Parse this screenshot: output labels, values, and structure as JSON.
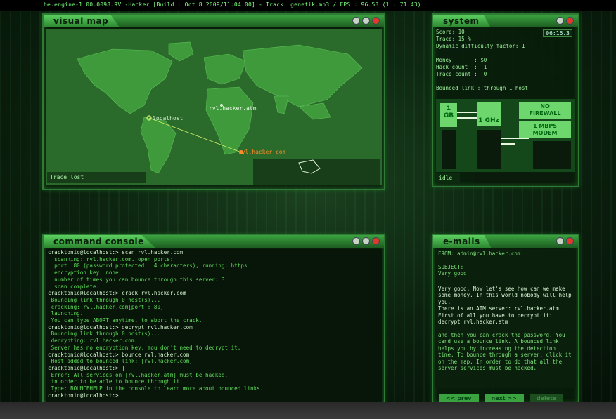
{
  "topbar": {
    "text": "he.engine-1.00.0098.RVL-Hacker [Build : Oct  8 2009/11:04:00] - Track: genetik.mp3 / FPS : 96.53 (1 : 71.43)"
  },
  "map_panel": {
    "title": "visual map",
    "status": "Trace lost",
    "nodes": {
      "localhost": "localhost",
      "atm": "rvl.hacker.atm",
      "com": "rvl.hacker.com"
    }
  },
  "system_panel": {
    "title": "system",
    "clock": "06:16.3",
    "lines": [
      "Score: 10",
      "Trace: 15 %",
      "Dynamic difficulty factor: 1",
      "",
      "Money       : $0",
      "Hack count  :  1",
      "Trace count :  0",
      "",
      "Bounced link : through 1 host"
    ],
    "hardware": {
      "ram": "1\nGB",
      "cpu": "1 GHz",
      "firewall": "NO\nFIREWALL",
      "modem": "1 MBPS\nMODEM"
    },
    "status": "idle"
  },
  "console_panel": {
    "title": "command console",
    "lines": [
      {
        "t": "cmd",
        "text": "cracktonic@localhost:> scan rvl.hacker.com"
      },
      {
        "t": "out",
        "text": "  scanning: rvl.hacker.com. open ports:"
      },
      {
        "t": "out",
        "text": "  port  80 (password protected:  4 characters), running: https"
      },
      {
        "t": "out",
        "text": "  encryption key: none"
      },
      {
        "t": "out",
        "text": "  number of times you can bounce through this server: 3"
      },
      {
        "t": "out",
        "text": "  scan complete."
      },
      {
        "t": "cmd",
        "text": "cracktonic@localhost:> crack rvl.hacker.com"
      },
      {
        "t": "out",
        "text": " Bouncing link through 0 host(s)..."
      },
      {
        "t": "out",
        "text": " cracking: rvl.hacker.com[port : 80]"
      },
      {
        "t": "out",
        "text": " launching."
      },
      {
        "t": "out",
        "text": " You can type ABORT anytime. to abort the crack."
      },
      {
        "t": "cmd",
        "text": "cracktonic@localhost:> decrypt rvl.hacker.com"
      },
      {
        "t": "out",
        "text": " Bouncing link through 0 host(s)..."
      },
      {
        "t": "out",
        "text": " decrypting: rvl.hacker.com"
      },
      {
        "t": "out",
        "text": " Server has no encryption key. You don't need to decrypt it."
      },
      {
        "t": "cmd",
        "text": "cracktonic@localhost:> bounce rvl.hacker.com"
      },
      {
        "t": "out",
        "text": " Host added to bounced link: [rvl.hacker.com]"
      },
      {
        "t": "cmd",
        "text": "cracktonic@localhost:> |"
      },
      {
        "t": "out",
        "text": " Error: All services on [rvl.hacker.atm] must be hacked."
      },
      {
        "t": "out",
        "text": " in order to be able to bounce through it."
      },
      {
        "t": "out",
        "text": " Type: BOUNCEHELP in the console to learn more about bounced links."
      },
      {
        "t": "cmd",
        "text": "cracktonic@localhost:>"
      }
    ]
  },
  "email_panel": {
    "title": "e-mails",
    "from": "FROM: admin@rvl.hacker.com",
    "subject_label": "SUBJECT:",
    "subject": "Very good",
    "body1": "Very good. Now let's see how can we make some money. In this world nobody will help you.",
    "body2": "There is an ATM server: rvl.hacker.atm First of all you have to decrypt it:",
    "body3": "decrypt rvl.hacker.atm",
    "body4": "and then you can crack the password. You cand use a bounce link. A bounced link helps you by increasing the detection time. To bounce through a server. click it on the map. In order to do that all the server services must be hacked.",
    "prev": "<< prev",
    "next": "next >>",
    "delete": "delete"
  },
  "colors": {
    "accent": "#3aa33f",
    "node": "#ff8c2a",
    "bg": "#0e2a12"
  }
}
